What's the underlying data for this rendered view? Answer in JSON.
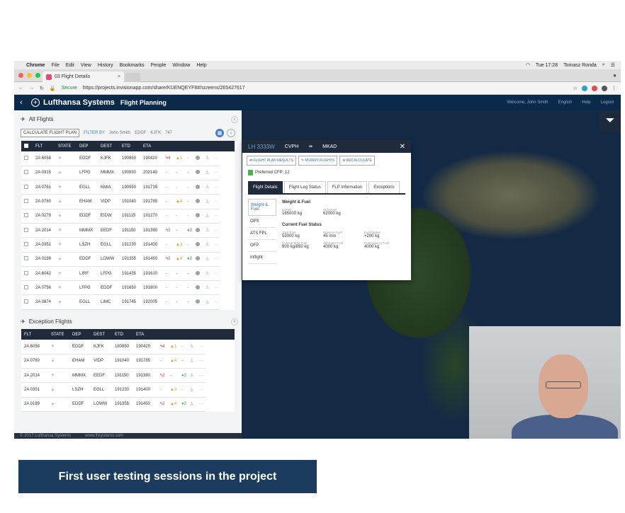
{
  "menubar": {
    "apple": "",
    "items": [
      "Chrome",
      "File",
      "Edit",
      "View",
      "History",
      "Bookmarks",
      "People",
      "Window",
      "Help"
    ],
    "clock": "Tue 17:28",
    "user": "Tomasz Ronda"
  },
  "browser": {
    "tab_title": "03 Flight Details",
    "secure_label": "Secure",
    "url": "https://projects.invisionapp.com/share/KUENQEYF8#/screens/265427617"
  },
  "app": {
    "brand": "Lufthansa Systems",
    "module": "Flight Planning",
    "welcome": "Welcome, John Smith",
    "language": "English",
    "help": "Help",
    "logout": "Logout"
  },
  "all_flights": {
    "title": "All Flights",
    "calc_button": "CALCULATE FLIGHT PLAN",
    "filter_by": "FILTER BY",
    "chips": [
      "John Smith",
      "EDDF",
      "KJFK",
      "747"
    ],
    "columns": [
      "FLT",
      "STATE",
      "DEP",
      "DEST",
      "ETD",
      "ETA"
    ],
    "rows": [
      {
        "flt": "2A 6058",
        "dep": "EDDF",
        "dest": "KJFK",
        "etd": "190850",
        "eta": "190420",
        "bolt": "4",
        "warn": "1",
        "pin": "-"
      },
      {
        "flt": "2A 0315",
        "dep": "LFPG",
        "dest": "MMMX",
        "etd": "190930",
        "eta": "202140",
        "bolt": "-",
        "warn": "-",
        "pin": "-"
      },
      {
        "flt": "2A 0761",
        "dep": "EGLL",
        "dest": "KMIA",
        "etd": "190950",
        "eta": "191735",
        "bolt": "-",
        "warn": "-",
        "pin": "-"
      },
      {
        "flt": "2A 0760",
        "dep": "EHAM",
        "dest": "VIDP",
        "etd": "191040",
        "eta": "191785",
        "bolt": "-",
        "warn": "4",
        "pin": "-"
      },
      {
        "flt": "2A 0279",
        "dep": "EDDF",
        "dest": "EIDW",
        "etd": "191115",
        "eta": "191270",
        "bolt": "-",
        "warn": "-",
        "pin": "-"
      },
      {
        "flt": "2A 2014",
        "dep": "MMMX",
        "dest": "EEDF",
        "etd": "191150",
        "eta": "191390",
        "bolt": "2",
        "warn": "-",
        "pin": "2"
      },
      {
        "flt": "2A 0351",
        "dep": "LSZH",
        "dest": "EGLL",
        "etd": "191230",
        "eta": "191400",
        "bolt": "-",
        "warn": "3",
        "pin": "-"
      },
      {
        "flt": "2A 0189",
        "dep": "EDDF",
        "dest": "LOWW",
        "etd": "191355",
        "eta": "191450",
        "bolt": "2",
        "warn": "4",
        "pin": "2"
      },
      {
        "flt": "2A 6042",
        "dep": "LIRF",
        "dest": "LFPG",
        "etd": "191435",
        "eta": "191610",
        "bolt": "-",
        "warn": "-",
        "pin": "-"
      },
      {
        "flt": "2A 0756",
        "dep": "LFPG",
        "dest": "EDDF",
        "etd": "191650",
        "eta": "191800",
        "bolt": "-",
        "warn": "-",
        "pin": "-"
      },
      {
        "flt": "2A 0874",
        "dep": "EGLL",
        "dest": "LIMC",
        "etd": "191745",
        "eta": "192005",
        "bolt": "-",
        "warn": "-",
        "pin": "-"
      }
    ]
  },
  "exception_flights": {
    "title": "Exception Flights",
    "columns": [
      "FLT",
      "STATE",
      "DEP",
      "DEST",
      "ETD",
      "ETA"
    ],
    "rows": [
      {
        "flt": "2A 6058",
        "dep": "EDDF",
        "dest": "KJFK",
        "etd": "190850",
        "eta": "190420",
        "bolt": "4",
        "warn": "1",
        "pin": "-"
      },
      {
        "flt": "2A 0760",
        "dep": "EHAM",
        "dest": "VIDP",
        "etd": "191040",
        "eta": "191785",
        "bolt": "-",
        "warn": "4",
        "pin": "-"
      },
      {
        "flt": "2A 2014",
        "dep": "MMMX",
        "dest": "EEDF",
        "etd": "191150",
        "eta": "191390",
        "bolt": "2",
        "warn": "-",
        "pin": "2"
      },
      {
        "flt": "2A 0351",
        "dep": "LSZH",
        "dest": "EGLL",
        "etd": "191230",
        "eta": "191400",
        "bolt": "-",
        "warn": "3",
        "pin": "-"
      },
      {
        "flt": "2A 0189",
        "dep": "EDDF",
        "dest": "LOWW",
        "etd": "191355",
        "eta": "191450",
        "bolt": "2",
        "warn": "4",
        "pin": "2"
      }
    ]
  },
  "footer": {
    "copyright": "© 2017 Lufthansa Systems",
    "site": "www.lhsystems.com"
  },
  "popup": {
    "flight": "LH 3333W",
    "from": "CVPH",
    "to": "MKAD",
    "btn_results": "FLIGHT PLAN RESULTS",
    "btn_modify": "MODIFY FLIGHTS",
    "btn_recalc": "RECALCULATE",
    "preferred": "Preferred CFP: 12",
    "tabs": [
      "Flight Details",
      "Flight Leg Status",
      "FLP Information",
      "Exceptions"
    ],
    "side": [
      "Weight & Fuel",
      "OPS",
      "ATS FPL",
      "OFP",
      "Inflight"
    ],
    "section1": "Weight & Fuel",
    "weights": [
      {
        "k": "EZFW",
        "v": "165000 kg"
      },
      {
        "k": "PLNTOW",
        "v": "62000 kg"
      }
    ],
    "section2": "Current Fuel Status",
    "fuel": [
      {
        "k": "Total Fuel",
        "v": "52000 kg"
      },
      {
        "k": "Reserve Fuel",
        "v": "45 min"
      },
      {
        "k": "Fuel Status",
        "v": "+200 kg"
      },
      {
        "k": "Consumable Fuel",
        "v": "900 kg/850 kg"
      },
      {
        "k": "Alternate Fuel",
        "v": "4000 kg"
      },
      {
        "k": "Contingency Fuel",
        "v": "4000 kg"
      }
    ]
  },
  "caption": "First user testing sessions in the project",
  "colors": {
    "header": "#0b2a4a",
    "table_head": "#1f2a3b",
    "accent": "#4a7dbb",
    "caption_bg": "#1b3c5e"
  }
}
